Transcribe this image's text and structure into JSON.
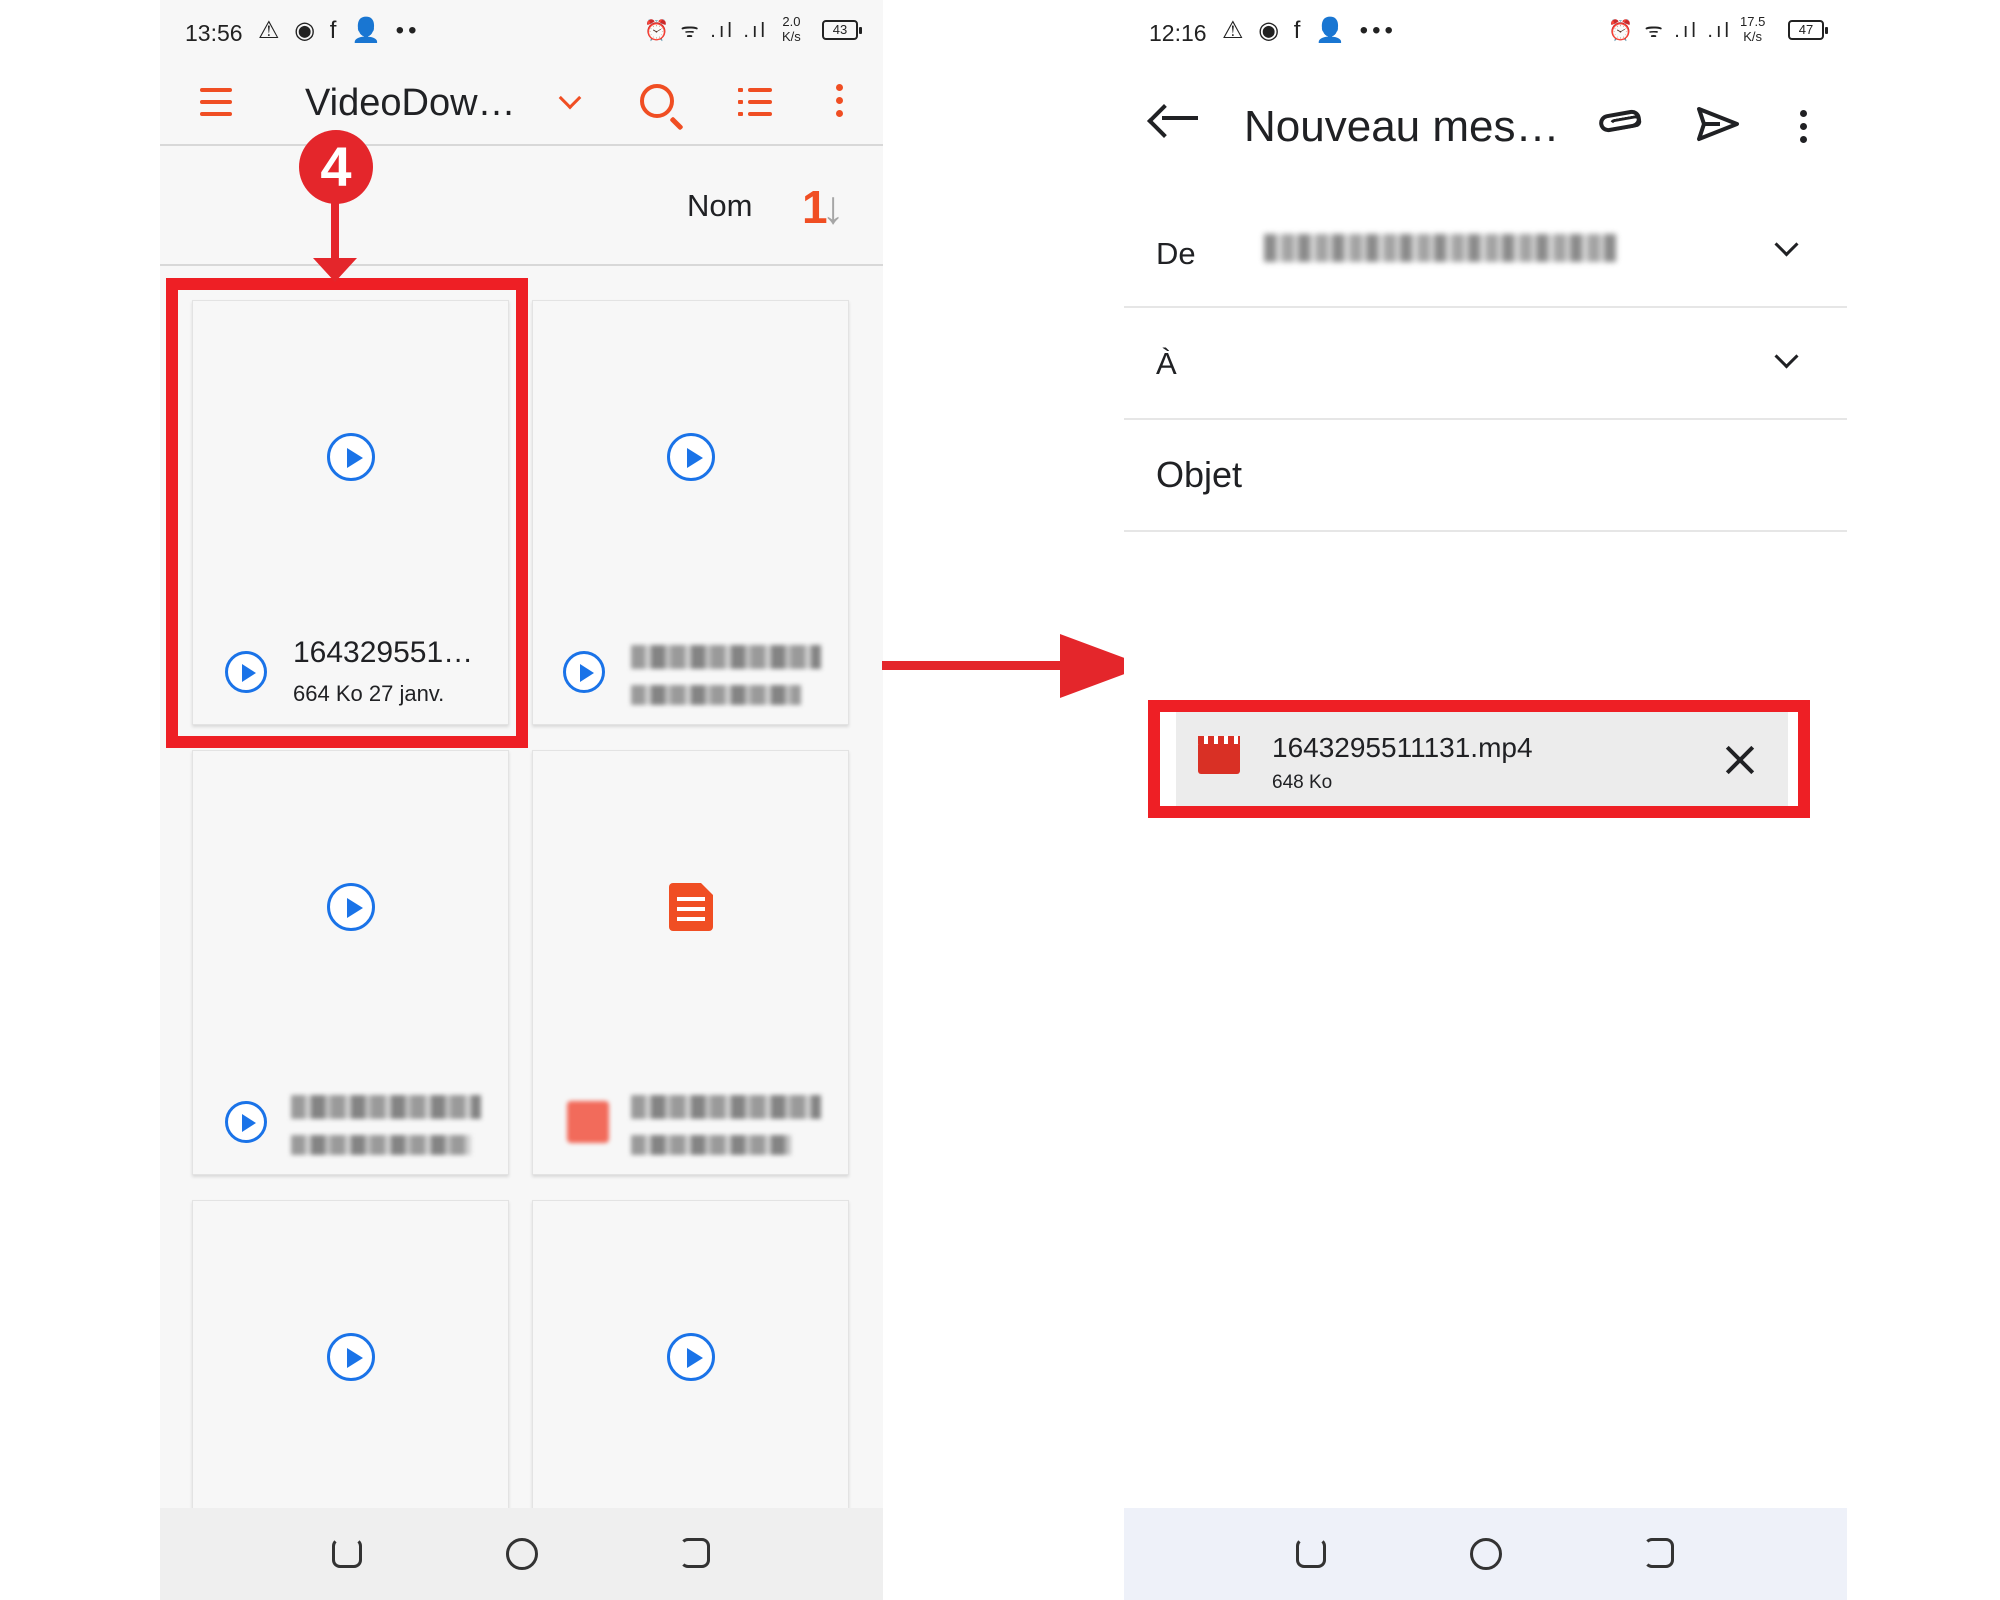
{
  "left": {
    "status": {
      "time": "13:56",
      "notif_icons": "⚠ ◉ f 👤 ••",
      "sys_icons": "⏰ ᯤ .ıl .ıl",
      "speed_value": "2.0",
      "speed_unit": "K/s",
      "battery": "43"
    },
    "toolbar": {
      "title": "VideoDow…"
    },
    "sort": {
      "label": "Nom",
      "icon_up": "1",
      "icon_down": "↓"
    },
    "files": [
      {
        "name": "164329551…",
        "size": "664 Ko",
        "date": "27 janv.",
        "icon": "play-icon",
        "blurred": false
      },
      {
        "name": "",
        "size": "",
        "date": "",
        "icon": "play-icon",
        "blurred": true
      },
      {
        "name": "",
        "size": "",
        "date": "",
        "icon": "play-icon",
        "blurred": true
      },
      {
        "name": "",
        "size": "",
        "date": "",
        "icon": "document-icon",
        "blurred": true
      },
      {
        "name": "",
        "size": "",
        "date": "",
        "icon": "play-icon",
        "blurred": true
      },
      {
        "name": "",
        "size": "",
        "date": "",
        "icon": "play-icon",
        "blurred": true
      }
    ],
    "step_badge": "4",
    "accent": "#f04e23"
  },
  "right": {
    "status": {
      "time": "12:16",
      "notif_icons": "⚠ ◉ f 👤 •••",
      "sys_icons": "⏰ ᯤ .ıl .ıl",
      "speed_value": "17.5",
      "speed_unit": "K/s",
      "battery": "47"
    },
    "toolbar": {
      "title": "Nouveau mes…"
    },
    "fields": {
      "from_label": "De",
      "to_label": "À",
      "subject_label": "Objet"
    },
    "attachment": {
      "name": "1643295511131.mp4",
      "size": "648 Ko"
    }
  },
  "annotation_color": "#ee1f25"
}
